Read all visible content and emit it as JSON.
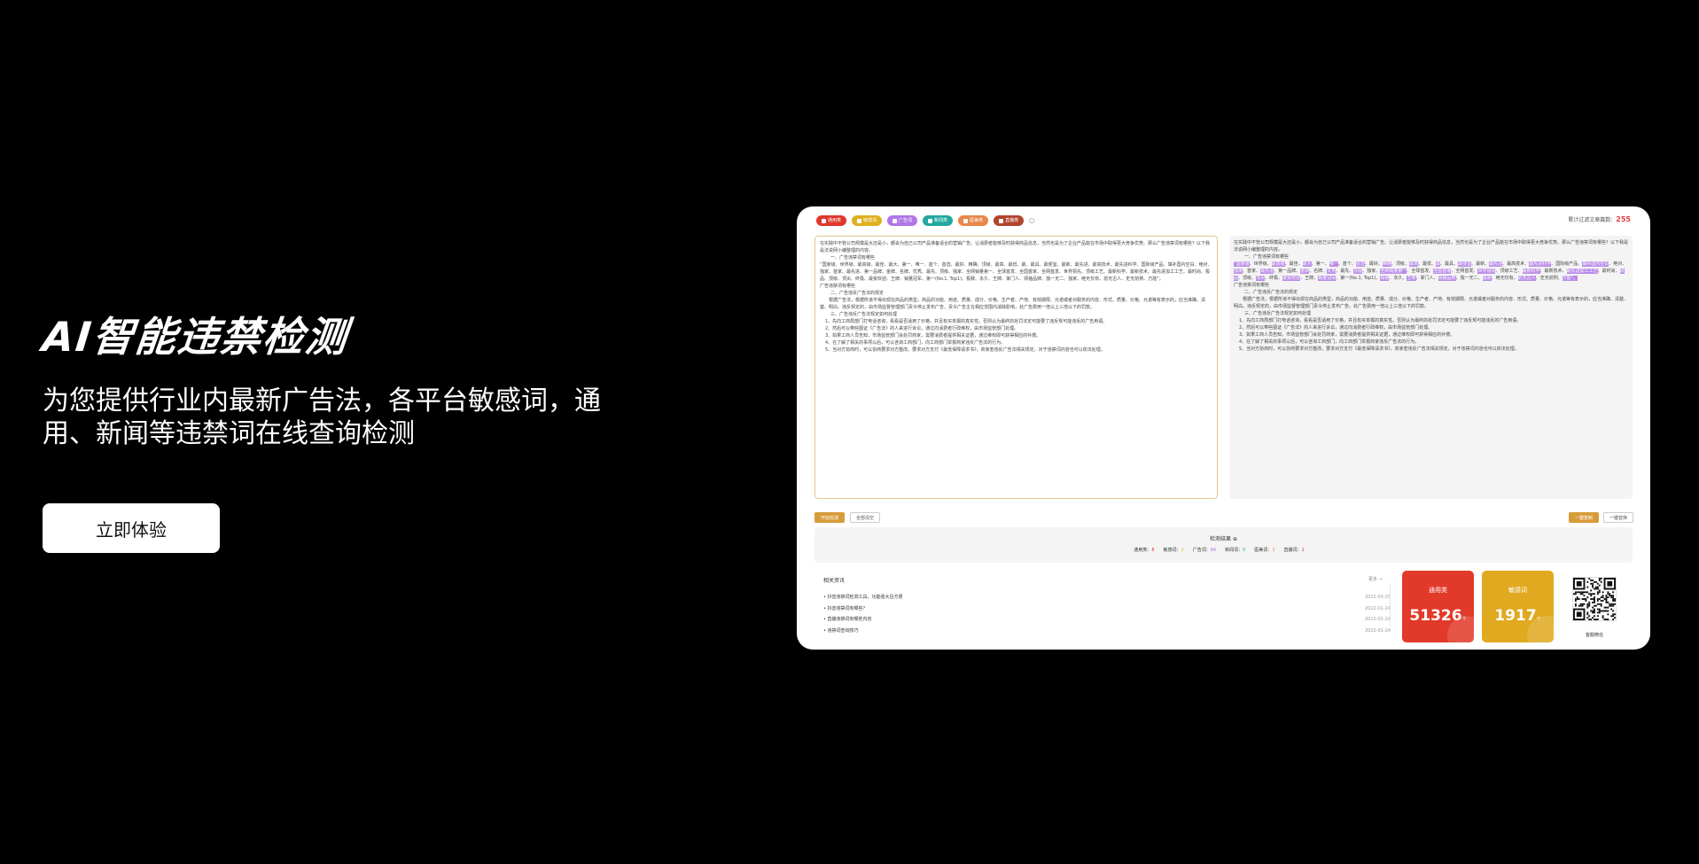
{
  "hero": {
    "title": "AI智能违禁检测",
    "subtitle": "为您提供行业内最新广告法，各平台敏感词，通用、新闻等违禁词在线查询检测",
    "cta_label": "立即体验"
  },
  "tool": {
    "tags": [
      {
        "label": "通用类",
        "color": "#e0362c"
      },
      {
        "label": "敏感词",
        "color": "#e0b021"
      },
      {
        "label": "广告词",
        "color": "#b077e8"
      },
      {
        "label": "新闻类",
        "color": "#23a8a0"
      },
      {
        "label": "医美类",
        "color": "#e8874a"
      },
      {
        "label": "直播类",
        "color": "#b2442c"
      }
    ],
    "counter_label": "累计过滤文章篇数：",
    "counter_value": "255",
    "start_button": "开始检测",
    "clear_button": "全部清空",
    "copy_button": "一键复制",
    "replace_button": "一键替换",
    "editor_text": [
      "在实践中不管公司规模是大还是小，都会为自己公司产品准备适合的营销广告。让消费者能够及时获得商品信息，当然也是为了企业产品能在市场中取得更大竞争优势。那么广告违禁词有哪些？以下我是法说网小编整理的内容。",
      "一、广告违禁词有哪些",
      "“国家级、世界级、最高级、最佳、最大、第一、唯一、首个、首选、最好、精确、顶级、最高、最低、最、最具、最便宜、最新、最先进、最高技术、最先进科学、国际级产品、填补国内空白、绝对、独家、首家、最先进、第一品牌、金牌、名牌、优秀、最先、顶级、独家、全网销量第一、全球首发、全国首家、全网首发、世界领先、顶级工艺、最新科学、最新技术、最先进加工工艺、最时尚、极品、顶级、顶尖、终极、最受欢迎、王牌、销量冠军、第一(No.1, Top1)、极致、永久、王牌、掌门人、领袖品牌、独一无二、独家、绝无仅有、前无古人、史无前例、万能”。",
      "广告违禁词有哪些",
      "二、广告违反广告法的规定",
      "根据广告法，根据所该不得出现在商品的类型，商品的功能、用途、质量、成分、价格、生产者、产地、有效期限、允诺或者对服务的内容、形式、质量、价格、允诺等有表示的，应当准确、清楚、明白。违反规定的，由市场监督管理部门责令停止发布广告，责令广告主在相应范围内消除影响，处广告费用一倍以上三倍以下的罚款。",
      "三、广告违反广告法规定如何处理",
      "1、先向工商局部门打电话咨询，看看是否适用了价格，并且有买单报的真实性。否则认为最终的处罚法定可能要了违反规可能违反的广告用语。",
      "2、然后可以带些图证《广告法》的人来进行诉讼，通过向消费者行政维权，由市场监管部门处理。",
      "3、如果工商人员告知，市场监管部门会处罚商家，需要消费者提供相关证据，通过维权即可获得相应的补偿。",
      "4、在了解了相关的事项以后，可以咨询工商部门，向工商部门举报商家违反广告法的行为。",
      "5、当对方协商时，可以协商要求对方整改，要求对方支付《最低保障请求书》，商家若违反广告法相关规定，对于违禁词内容也可以依法处理。"
    ],
    "result_text": [
      "在实践中不管公司规模是大还是小，都会为自己公司产品准备适合的营销广告。让消费者能够及时获得商品信息，当然也是为了企业产品能在市场中取得更大竞争优势。那么广告违禁词有哪些？以下我是法说网小编整理的内容。",
      "一、广告违禁词有哪些",
      "“国家级、世界级、最高级、最佳、最大、第一、唯一、首个、首选、最好、精确、顶级、最高、最低、最、最具、最便宜、最新、最先进、最高技术、最先进科学、国际级产品、填补国内空白、绝对、独家、首家、最先进、第一品牌、金牌、名牌、优秀、最先、顶级、独家、全网销量第一、全球首发、全国首家、全网首发、世界领先、顶级工艺、最新科学、最新技术、最先进加工工艺、最时尚、极品、顶级、顶尖、终极、最受欢迎、王牌、销量冠军、第一(No.1, Top1)、极致、永久、王牌、掌门人、领袖品牌、独一无二、独家、绝无仅有、前无古人、史无前例、万能”。",
      "广告违禁词有哪些",
      "二、广告违反广告法的规定",
      "根据广告法，根据所该不得出现在商品的类型，商品的功能、用途、质量、成分、价格、生产者、产地、有效期限、允诺或者对服务的内容、形式、质量、价格、允诺等有表示的，应当准确、清楚、明白。违反规定的，由市场监督管理部门责令停止发布广告，处广告费用一倍以上三倍以下的罚款。",
      "三、广告违反广告法规定如何处理",
      "1、先向工商局部门打电话咨询，看看是否适用了价格，并且有买单报的真实性。否则认为最终的处罚法定可能要了违反规可能违反的广告用语。",
      "2、然后可以带些图证《广告法》的人来进行诉讼，通过向消费者行政维权，由市场监管部门处理。",
      "3、如果工商人员告知，市场监管部门会处罚商家，需要消费者提供相关证据，通过维权即可获得相应的补偿。",
      "4、在了解了相关的事项以后，可以咨询工商部门，向工商部门举报商家违反广告法的行为。",
      "5、当对方协商时，可以协商要求对方整改，要求对方支付《最低保障请求书》，商家若违反广告法相关规定，对于违禁词内容也可以依法处理。"
    ],
    "summary": {
      "title": "检测结果 ⊕",
      "stats": [
        {
          "label": "通用类：",
          "value": "8",
          "color": "#e0362c"
        },
        {
          "label": "敏感词：",
          "value": "1",
          "color": "#e0b021"
        },
        {
          "label": "广告词：",
          "value": "64",
          "color": "#b077e8"
        },
        {
          "label": "新闻词：",
          "value": "0",
          "color": "#23a8a0"
        },
        {
          "label": "医美词：",
          "value": "3",
          "color": "#e8874a"
        },
        {
          "label": "直播词：",
          "value": "1",
          "color": "#b2442c"
        }
      ]
    },
    "news": {
      "title": "相关资讯",
      "more_label": "更多 →",
      "items": [
        {
          "title": "• 抖音违禁词检测工具，功能强大且方便",
          "date": "2022-03-25"
        },
        {
          "title": "• 抖音违禁词有哪些？",
          "date": "2022-01-24"
        },
        {
          "title": "• 直播违禁词有哪些内容",
          "date": "2022-01-24"
        },
        {
          "title": "• 违禁词查询技巧",
          "date": "2022-01-24"
        }
      ]
    },
    "cards": [
      {
        "title": "通用类",
        "value": "51326",
        "unit": "个"
      },
      {
        "title": "敏感词",
        "value": "1917",
        "unit": "个"
      }
    ],
    "qr_label": "客服微信"
  }
}
